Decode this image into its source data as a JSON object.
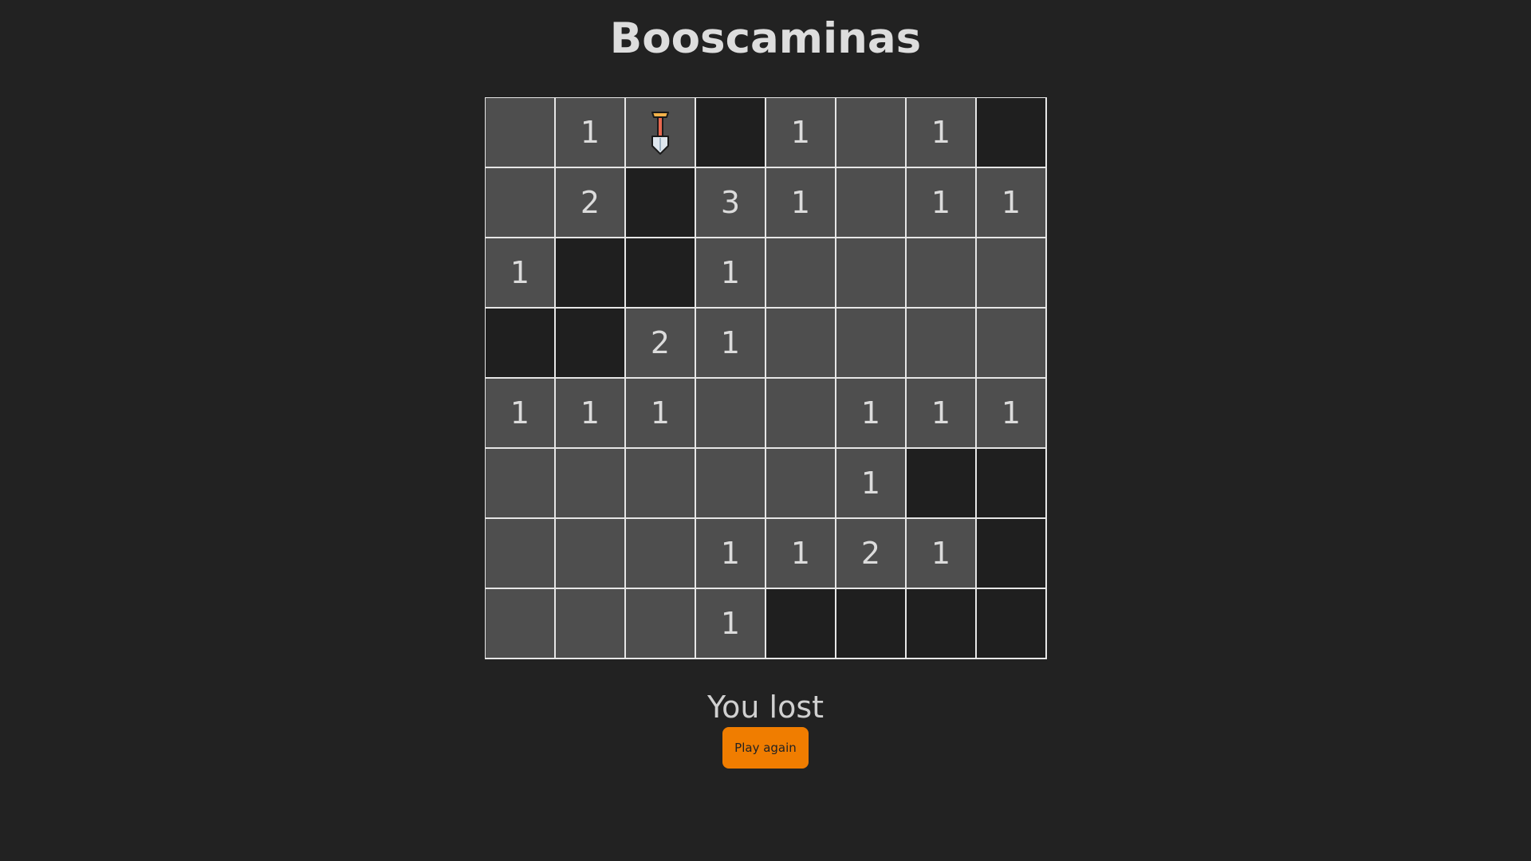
{
  "title": "Booscaminas",
  "status": "You lost",
  "play_again_label": "Play again",
  "colors": {
    "background": "#222222",
    "revealed_cell": "#4e4e4e",
    "hidden_cell": "#1f1f1f",
    "grid_line": "#e6e6e6",
    "accent": "#f07d00"
  },
  "board": {
    "rows": 8,
    "cols": 8,
    "cells": [
      [
        {
          "state": "revealed",
          "value": ""
        },
        {
          "state": "revealed",
          "value": "1"
        },
        {
          "state": "revealed",
          "value": "",
          "icon": "shovel-icon"
        },
        {
          "state": "hidden",
          "value": ""
        },
        {
          "state": "revealed",
          "value": "1"
        },
        {
          "state": "revealed",
          "value": ""
        },
        {
          "state": "revealed",
          "value": "1"
        },
        {
          "state": "hidden",
          "value": ""
        }
      ],
      [
        {
          "state": "revealed",
          "value": ""
        },
        {
          "state": "revealed",
          "value": "2"
        },
        {
          "state": "hidden",
          "value": ""
        },
        {
          "state": "revealed",
          "value": "3"
        },
        {
          "state": "revealed",
          "value": "1"
        },
        {
          "state": "revealed",
          "value": ""
        },
        {
          "state": "revealed",
          "value": "1"
        },
        {
          "state": "revealed",
          "value": "1"
        }
      ],
      [
        {
          "state": "revealed",
          "value": "1"
        },
        {
          "state": "hidden",
          "value": ""
        },
        {
          "state": "hidden",
          "value": ""
        },
        {
          "state": "revealed",
          "value": "1"
        },
        {
          "state": "revealed",
          "value": ""
        },
        {
          "state": "revealed",
          "value": ""
        },
        {
          "state": "revealed",
          "value": ""
        },
        {
          "state": "revealed",
          "value": ""
        }
      ],
      [
        {
          "state": "hidden",
          "value": ""
        },
        {
          "state": "hidden",
          "value": ""
        },
        {
          "state": "revealed",
          "value": "2"
        },
        {
          "state": "revealed",
          "value": "1"
        },
        {
          "state": "revealed",
          "value": ""
        },
        {
          "state": "revealed",
          "value": ""
        },
        {
          "state": "revealed",
          "value": ""
        },
        {
          "state": "revealed",
          "value": ""
        }
      ],
      [
        {
          "state": "revealed",
          "value": "1"
        },
        {
          "state": "revealed",
          "value": "1"
        },
        {
          "state": "revealed",
          "value": "1"
        },
        {
          "state": "revealed",
          "value": ""
        },
        {
          "state": "revealed",
          "value": ""
        },
        {
          "state": "revealed",
          "value": "1"
        },
        {
          "state": "revealed",
          "value": "1"
        },
        {
          "state": "revealed",
          "value": "1"
        }
      ],
      [
        {
          "state": "revealed",
          "value": ""
        },
        {
          "state": "revealed",
          "value": ""
        },
        {
          "state": "revealed",
          "value": ""
        },
        {
          "state": "revealed",
          "value": ""
        },
        {
          "state": "revealed",
          "value": ""
        },
        {
          "state": "revealed",
          "value": "1"
        },
        {
          "state": "hidden",
          "value": ""
        },
        {
          "state": "hidden",
          "value": ""
        }
      ],
      [
        {
          "state": "revealed",
          "value": ""
        },
        {
          "state": "revealed",
          "value": ""
        },
        {
          "state": "revealed",
          "value": ""
        },
        {
          "state": "revealed",
          "value": "1"
        },
        {
          "state": "revealed",
          "value": "1"
        },
        {
          "state": "revealed",
          "value": "2"
        },
        {
          "state": "revealed",
          "value": "1"
        },
        {
          "state": "hidden",
          "value": ""
        }
      ],
      [
        {
          "state": "revealed",
          "value": ""
        },
        {
          "state": "revealed",
          "value": ""
        },
        {
          "state": "revealed",
          "value": ""
        },
        {
          "state": "revealed",
          "value": "1"
        },
        {
          "state": "hidden",
          "value": ""
        },
        {
          "state": "hidden",
          "value": ""
        },
        {
          "state": "hidden",
          "value": ""
        },
        {
          "state": "hidden",
          "value": ""
        }
      ]
    ]
  }
}
